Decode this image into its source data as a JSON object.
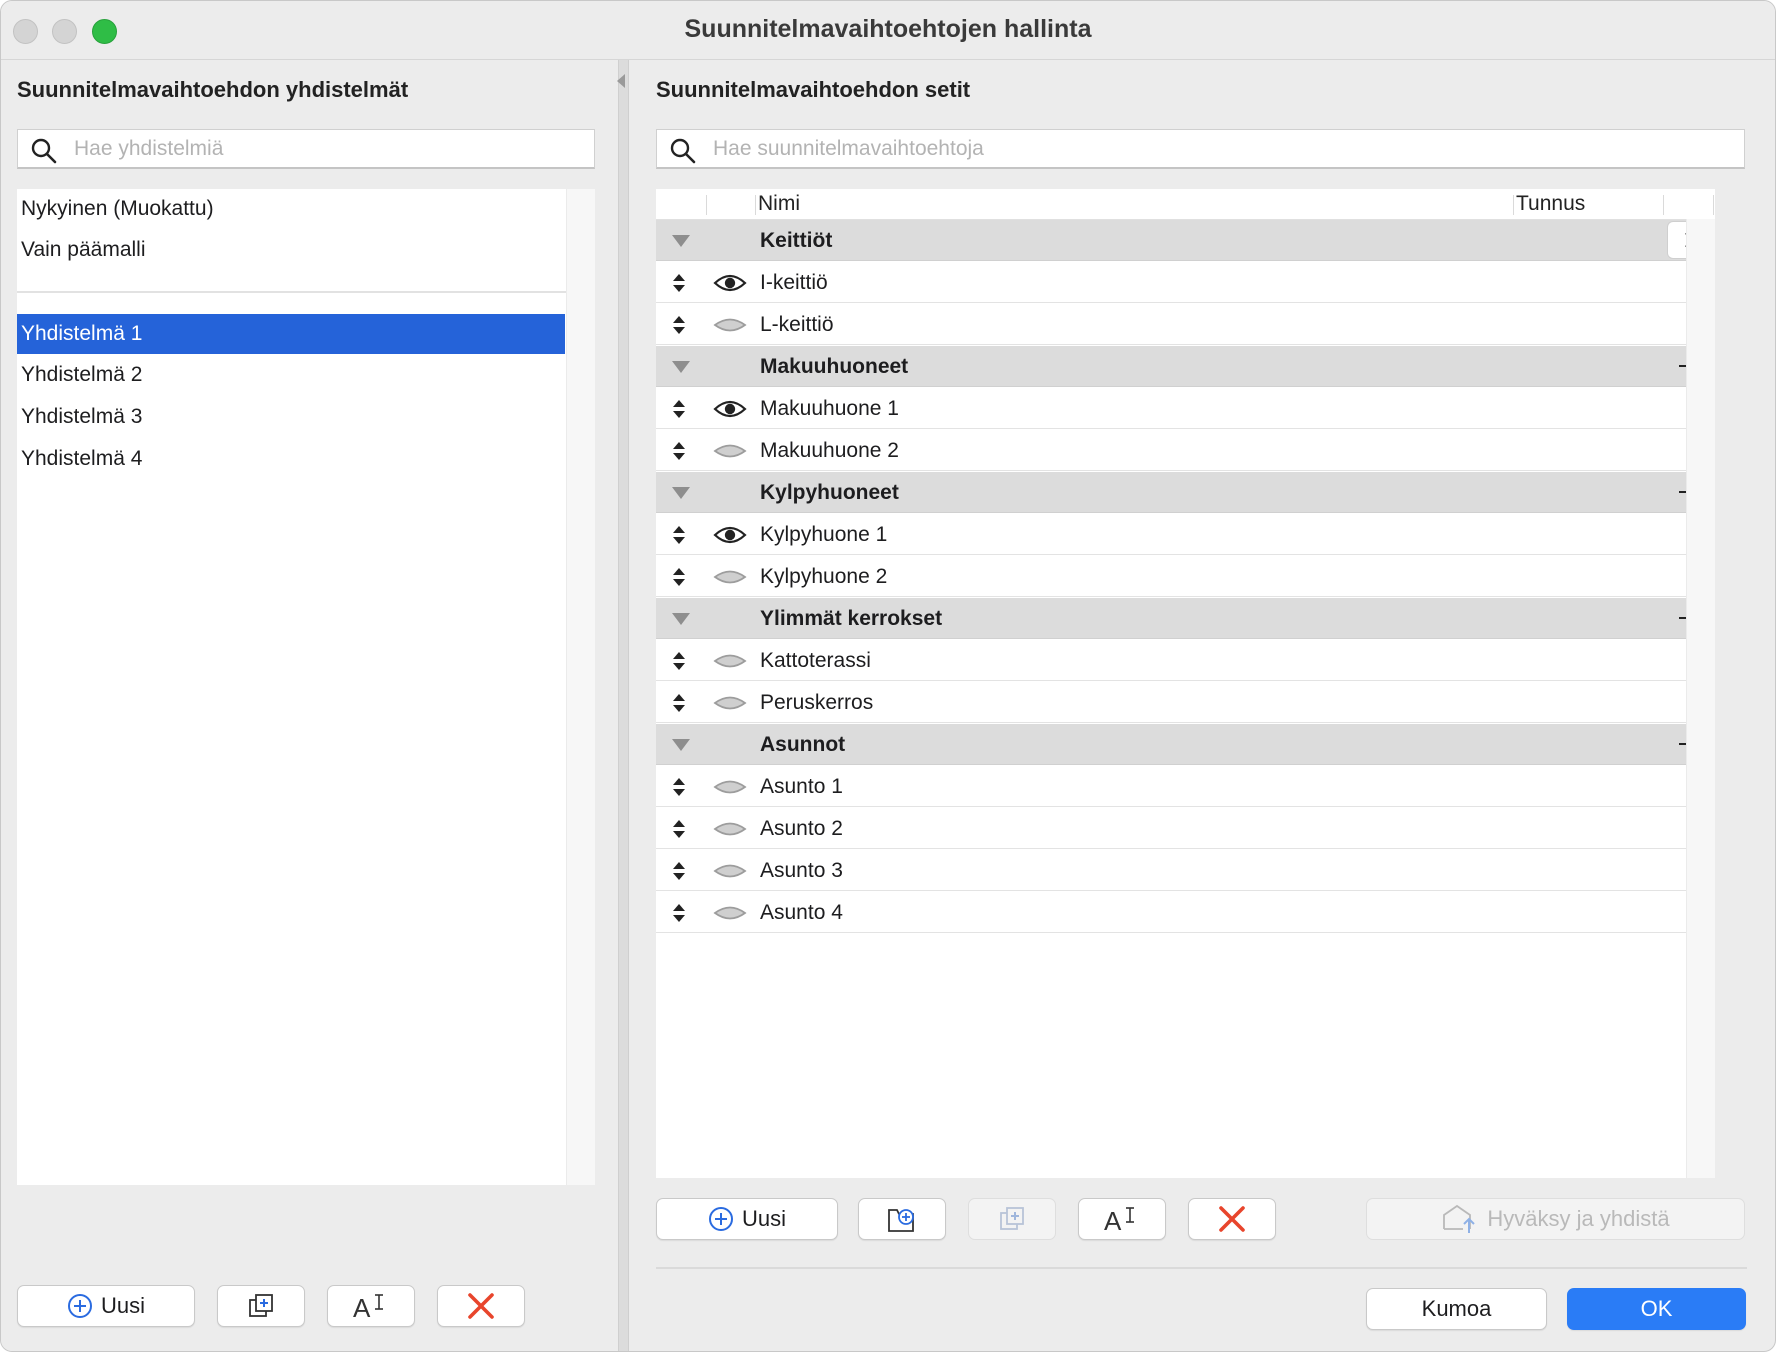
{
  "window": {
    "title": "Suunnitelmavaihtoehtojen hallinta"
  },
  "left": {
    "heading": "Suunnitelmavaihtoehdon yhdistelmät",
    "search_placeholder": "Hae yhdistelmiä",
    "top_items": [
      "Nykyinen (Muokattu)",
      "Vain päämalli"
    ],
    "items": [
      {
        "label": "Yhdistelmä 1",
        "selected": true
      },
      {
        "label": "Yhdistelmä 2",
        "selected": false
      },
      {
        "label": "Yhdistelmä 3",
        "selected": false
      },
      {
        "label": "Yhdistelmä 4",
        "selected": false
      }
    ],
    "new_label": "Uusi"
  },
  "right": {
    "heading": "Suunnitelmavaihtoehdon setit",
    "search_placeholder": "Hae suunnitelmavaihtoehtoja",
    "columns": {
      "name": "Nimi",
      "id": "Tunnus"
    },
    "groups": [
      {
        "name": "Keittiöt",
        "action": "chevron-right-icon",
        "options": [
          {
            "name": "I-keittiö",
            "visible": true
          },
          {
            "name": "L-keittiö",
            "visible": false
          }
        ]
      },
      {
        "name": "Makuuhuoneet",
        "action": "plus-icon",
        "options": [
          {
            "name": "Makuuhuone 1",
            "visible": true
          },
          {
            "name": "Makuuhuone 2",
            "visible": false
          }
        ]
      },
      {
        "name": "Kylpyhuoneet",
        "action": "plus-icon",
        "options": [
          {
            "name": "Kylpyhuone 1",
            "visible": true
          },
          {
            "name": "Kylpyhuone 2",
            "visible": false
          }
        ]
      },
      {
        "name": "Ylimmät kerrokset",
        "action": "plus-icon",
        "options": [
          {
            "name": "Kattoterassi",
            "visible": false
          },
          {
            "name": "Peruskerros",
            "visible": false
          }
        ]
      },
      {
        "name": "Asunnot",
        "action": "plus-icon",
        "options": [
          {
            "name": "Asunto 1",
            "visible": false
          },
          {
            "name": "Asunto 2",
            "visible": false
          },
          {
            "name": "Asunto 3",
            "visible": false
          },
          {
            "name": "Asunto 4",
            "visible": false
          }
        ]
      }
    ],
    "new_label": "Uusi",
    "accept_label": "Hyväksy ja yhdistä"
  },
  "footer": {
    "cancel_label": "Kumoa",
    "ok_label": "OK"
  },
  "colors": {
    "selection": "#2563d9",
    "primary": "#2a7cf6",
    "delete": "#e8452c",
    "plus_blue": "#2a6be0"
  }
}
